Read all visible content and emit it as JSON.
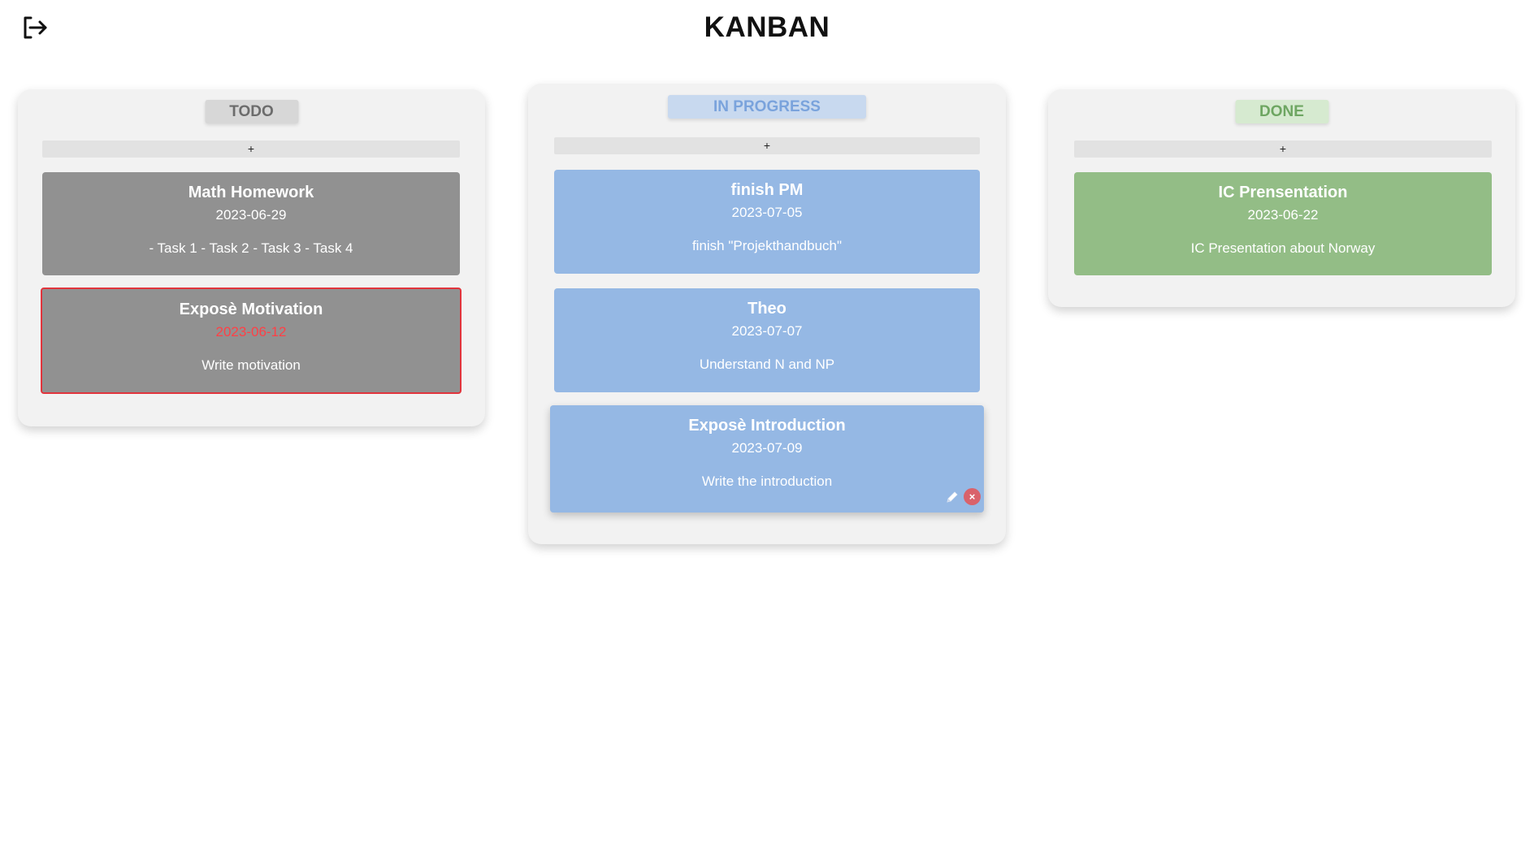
{
  "header": {
    "title": "KANBAN",
    "logout_icon": "logout-icon"
  },
  "colors": {
    "todo_card": "#919191",
    "progress_card": "#95b8e4",
    "done_card": "#93bd86",
    "overdue": "#e1343c"
  },
  "columns": [
    {
      "title": "TODO",
      "add_label": "+",
      "cards": [
        {
          "title": "Math Homework",
          "date": "2023-06-29",
          "description": "- Task 1 - Task 2 - Task 3 - Task 4"
        },
        {
          "title": "Exposè Motivation",
          "date": "2023-06-12",
          "description": "Write motivation",
          "overdue": true
        }
      ]
    },
    {
      "title": "IN PROGRESS",
      "add_label": "+",
      "cards": [
        {
          "title": "finish PM",
          "date": "2023-07-05",
          "description": "finish \"Projekthandbuch\""
        },
        {
          "title": "Theo",
          "date": "2023-07-07",
          "description": "Understand N and NP"
        },
        {
          "title": "Exposè Introduction",
          "date": "2023-07-09",
          "description": "Write the introduction",
          "actions": {
            "edit_icon": "pencil-icon",
            "delete_icon": "close-icon",
            "delete_glyph": "×"
          }
        }
      ]
    },
    {
      "title": "DONE",
      "add_label": "+",
      "cards": [
        {
          "title": "IC Prensentation",
          "date": "2023-06-22",
          "description": "IC Presentation about Norway"
        }
      ]
    }
  ]
}
